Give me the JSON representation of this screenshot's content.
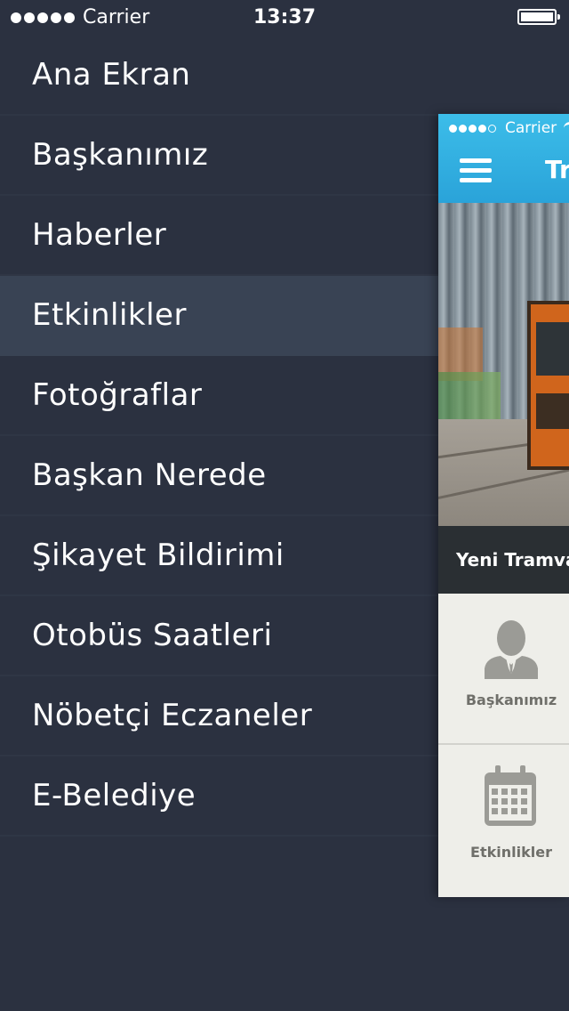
{
  "status_bar": {
    "carrier": "Carrier",
    "time": "13:37"
  },
  "menu": {
    "items": [
      {
        "label": "Ana Ekran"
      },
      {
        "label": "Başkanımız"
      },
      {
        "label": "Haberler"
      },
      {
        "label": "Etkinlikler",
        "active": true
      },
      {
        "label": "Fotoğraflar"
      },
      {
        "label": "Başkan Nerede"
      },
      {
        "label": "Şikayet Bildirimi"
      },
      {
        "label": "Otobüs Saatleri"
      },
      {
        "label": "Nöbetçi Eczaneler"
      },
      {
        "label": "E-Belediye"
      }
    ]
  },
  "main": {
    "status_carrier": "Carrier",
    "header_title": "Tra",
    "hero_caption": "Yeni Tramva",
    "tiles": [
      {
        "label": "Başkanımız",
        "icon": "person-icon"
      },
      {
        "label": "Etkinlikler",
        "icon": "calendar-icon"
      }
    ]
  },
  "colors": {
    "menu_background": "#2b3140",
    "menu_active": "#394354",
    "header_blue": "#2aa3d9",
    "tile_background": "#eeeee9",
    "tile_icon": "#9b9b96"
  }
}
